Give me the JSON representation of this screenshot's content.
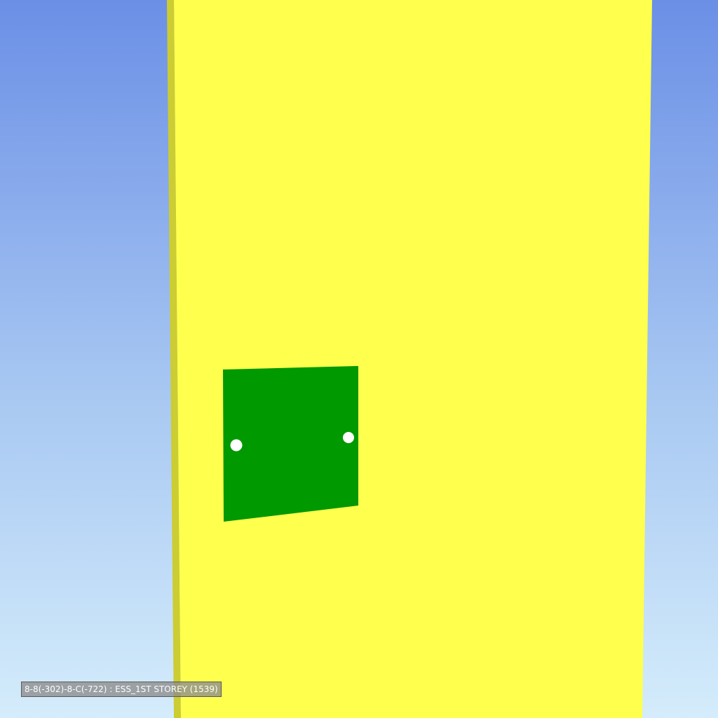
{
  "viewport": {
    "status_label": "8-8(-302)-8-C(-722) : ESS_1ST STOREY (1539)"
  },
  "colors": {
    "sky_top": "#6b8fe6",
    "sky_bottom": "#d4ecfb",
    "column_face": "#ffff4d",
    "column_side": "#cccc33",
    "plate": "#009900",
    "bolt": "#ffffff"
  },
  "scene_objects": {
    "column": "steel-column",
    "plate": "connection-plate",
    "bolts": [
      "bolt-left",
      "bolt-right"
    ]
  }
}
